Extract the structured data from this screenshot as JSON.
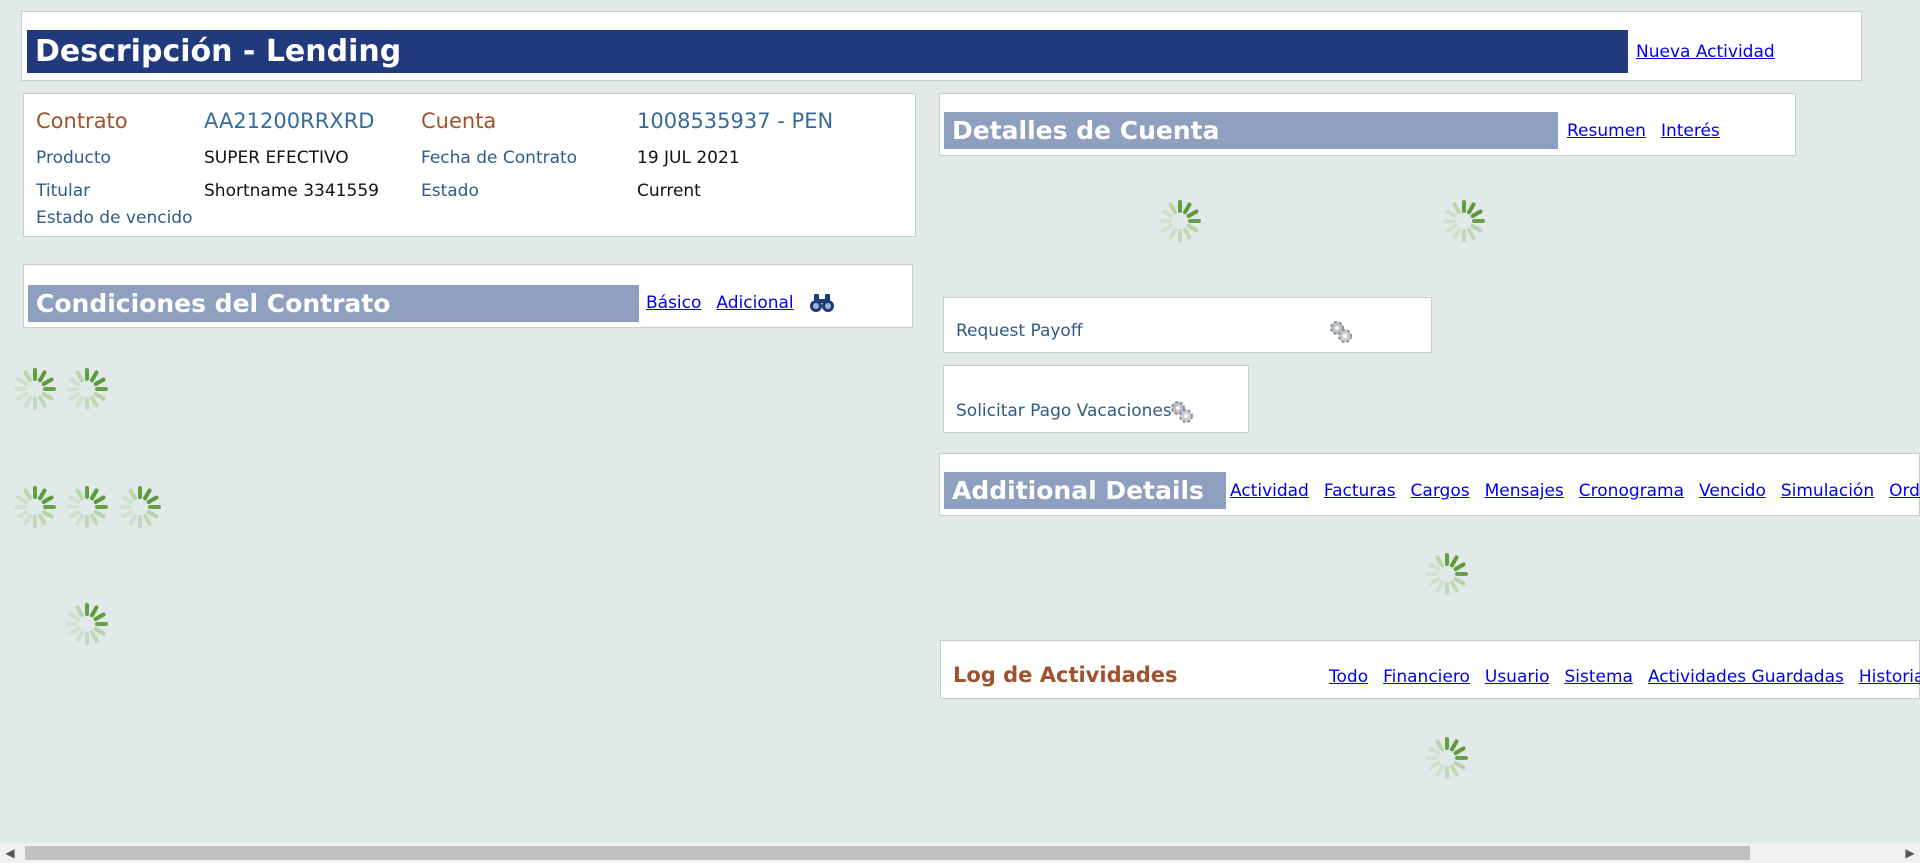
{
  "header": {
    "title": "Descripción - Lending",
    "new_activity": "Nueva Actividad"
  },
  "contract": {
    "contrato_label": "Contrato",
    "contrato_value": "AA21200RRXRD",
    "cuenta_label": "Cuenta",
    "cuenta_value": "1008535937 - PEN",
    "producto_label": "Producto",
    "producto_value": "SUPER EFECTIVO",
    "fecha_label": "Fecha de Contrato",
    "fecha_value": "19 JUL 2021",
    "titular_label": "Titular",
    "titular_value": "Shortname 3341559",
    "estado_label": "Estado",
    "estado_value": "Current",
    "vencido_label": "Estado de vencido"
  },
  "conditions": {
    "title": "Condiciones del Contrato",
    "tabs": [
      "Básico",
      "Adicional"
    ],
    "icon": "binoculars-icon"
  },
  "account_details": {
    "title": "Detalles de Cuenta",
    "tabs": [
      "Resumen",
      "Interés"
    ]
  },
  "payoff": {
    "label": "Request Payoff",
    "icon": "gears-icon"
  },
  "vacation": {
    "label": "Solicitar Pago Vacaciones",
    "icon": "gears-icon"
  },
  "additional": {
    "title": "Additional Details",
    "tabs": [
      "Actividad",
      "Facturas",
      "Cargos",
      "Mensajes",
      "Cronograma",
      "Vencido",
      "Simulación",
      "Ordenes"
    ]
  },
  "activity_log": {
    "title": "Log de Actividades",
    "tabs": [
      "Todo",
      "Financiero",
      "Usuario",
      "Sistema",
      "Actividades Guardadas",
      "Historial"
    ]
  },
  "colors": {
    "header_bar": "#21397d",
    "section_bar": "#8f9fbf",
    "background": "#e1eae8",
    "link": "#0000ee"
  }
}
